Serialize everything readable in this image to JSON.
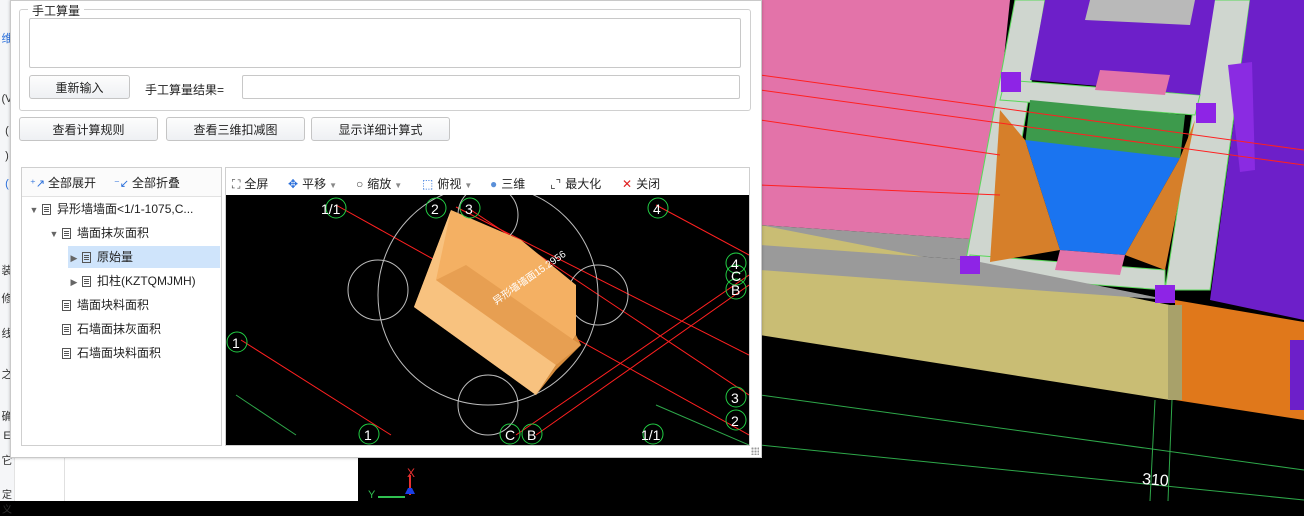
{
  "background_app": {
    "left_nav_chars": [
      "维",
      "(V",
      "(",
      ")",
      "(",
      "装",
      "修",
      "线",
      "之",
      "确",
      "E",
      "它",
      "定义"
    ],
    "dimension_label": "310"
  },
  "dialog": {
    "manual_group": {
      "title": "手工算量",
      "reenter_button": "重新输入",
      "result_label": "手工算量结果=",
      "result_value": ""
    },
    "buttons": {
      "view_rules": "查看计算规则",
      "view_3d_deduction": "查看三维扣减图",
      "show_formula": "显示详细计算式"
    },
    "tree": {
      "expand_all": "全部展开",
      "collapse_all": "全部折叠",
      "items": [
        {
          "label": "异形墙墙面<1/1-1075,C..."
        },
        {
          "label": "墙面抹灰面积"
        },
        {
          "label": "原始量"
        },
        {
          "label": "扣柱(KZTQMJMH)"
        },
        {
          "label": "墙面块料面积"
        },
        {
          "label": "石墙面抹灰面积"
        },
        {
          "label": "石墙面块料面积"
        }
      ]
    },
    "viewer": {
      "toolbar": {
        "fullscreen": "全屏",
        "pan": "平移",
        "zoom": "缩放",
        "top_view": "俯视",
        "three_d": "三维",
        "maximize": "最大化",
        "close": "关闭"
      },
      "axis_labels": {
        "top_1_1": "1/1",
        "top_2": "2",
        "top_3": "3",
        "top_4": "4",
        "right_4": "4",
        "right_C": "C",
        "right_B": "B",
        "right_3": "3",
        "right_2": "2",
        "left_1": "1",
        "bottom_1": "1",
        "bottom_C": "C",
        "bottom_B": "B",
        "bottom_1_1": "1/1"
      },
      "wall_label": "异形墙墙面15.2956"
    }
  },
  "icons": {
    "expand": "expand-all-icon",
    "collapse": "collapse-all-icon",
    "fullscreen": "fullscreen-icon",
    "pan": "pan-icon",
    "zoom": "zoom-icon",
    "top_view": "cube-icon",
    "three_d": "sphere-icon",
    "maximize": "maximize-icon",
    "close": "close-icon",
    "tree_node": "document-icon"
  },
  "colors": {
    "accent": "#2a6fdb",
    "selected_row": "#cfe4fb",
    "wall_face": "#f4b063",
    "grid_line": "#ff2020",
    "axis_circle": "#22cc44"
  }
}
